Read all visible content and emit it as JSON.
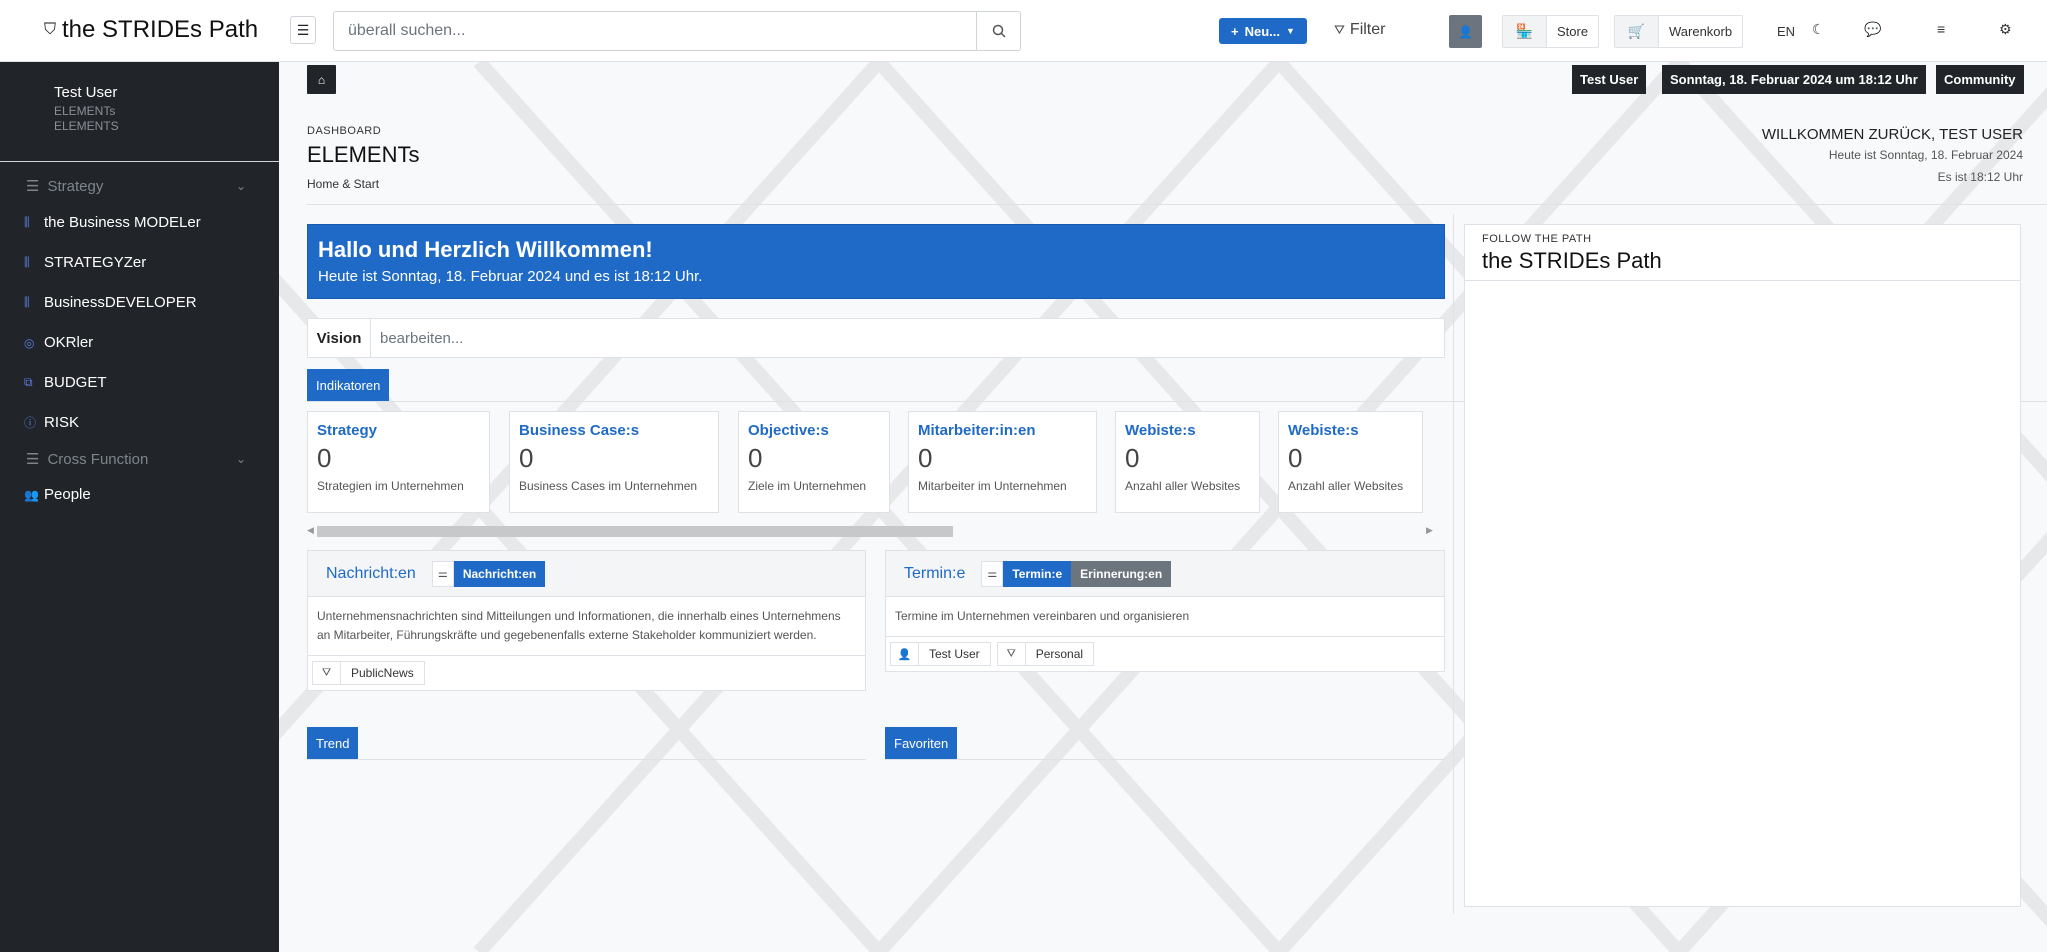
{
  "header": {
    "brand": "the STRIDEs Path",
    "search_placeholder": "überall suchen...",
    "new_label": "Neu...",
    "filter_label": "Filter",
    "store_label": "Store",
    "cart_label": "Warenkorb",
    "lang": "EN"
  },
  "sidebar": {
    "user_name": "Test User",
    "user_sub1": "ELEMENTs",
    "user_sub2": "ELEMENTS",
    "group1": "Strategy",
    "items1": [
      "the Business MODELer",
      "STRATEGYZer",
      "BusinessDEVELOPER",
      "OKRler",
      "BUDGET",
      "RISK"
    ],
    "group2": "Cross Function",
    "items2": [
      "People"
    ]
  },
  "topbadges": {
    "user": "Test User",
    "datetime": "Sonntag, 18. Februar 2024 um 18:12 Uhr",
    "community": "Community"
  },
  "page": {
    "crumb": "DASHBOARD",
    "title": "ELEMENTs",
    "subtitle": "Home & Start",
    "welcome": "WILLKOMMEN ZURÜCK, TEST USER",
    "today": "Heute ist Sonntag, 18. Februar 2024",
    "time": "Es ist 18:12 Uhr"
  },
  "hero": {
    "title": "Hallo und Herzlich Willkommen!",
    "text": "Heute ist Sonntag, 18. Februar 2024 und es ist 18:12 Uhr."
  },
  "vision": {
    "label": "Vision",
    "value": "bearbeiten..."
  },
  "indicators_tab": "Indikatoren",
  "cards": [
    {
      "title": "Strategy",
      "value": "0",
      "desc": "Strategien im Unternehmen"
    },
    {
      "title": "Business Case:s",
      "value": "0",
      "desc": "Business Cases im Unternehmen"
    },
    {
      "title": "Objective:s",
      "value": "0",
      "desc": "Ziele im Unternehmen"
    },
    {
      "title": "Mitarbeiter:in:en",
      "value": "0",
      "desc": "Mitarbeiter im Unternehmen"
    },
    {
      "title": "Webiste:s",
      "value": "0",
      "desc": "Anzahl aller Websites"
    },
    {
      "title": "Webiste:s",
      "value": "0",
      "desc": "Anzahl aller Websites"
    }
  ],
  "news": {
    "title": "Nachricht:en",
    "btn": "Nachricht:en",
    "body": "Unternehmensnachrichten sind Mitteilungen und Informationen, die innerhalb eines Unternehmens an Mitarbeiter, Führungskräfte und gegebenenfalls externe Stakeholder kommuniziert werden.",
    "chip": "PublicNews"
  },
  "events": {
    "title": "Termin:e",
    "btn1": "Termin:e",
    "btn2": "Erinnerung:en",
    "body": "Termine im Unternehmen vereinbaren und organisieren",
    "chip1": "Test User",
    "chip2": "Personal"
  },
  "bottom_tabs": {
    "trend": "Trend",
    "favorites": "Favoriten"
  },
  "right_panel": {
    "small": "FOLLOW THE PATH",
    "title": "the STRIDEs Path"
  },
  "colors": {
    "accent": "#1f6ac7",
    "sidebar_bg": "#212529",
    "secondary": "#6c757d"
  }
}
